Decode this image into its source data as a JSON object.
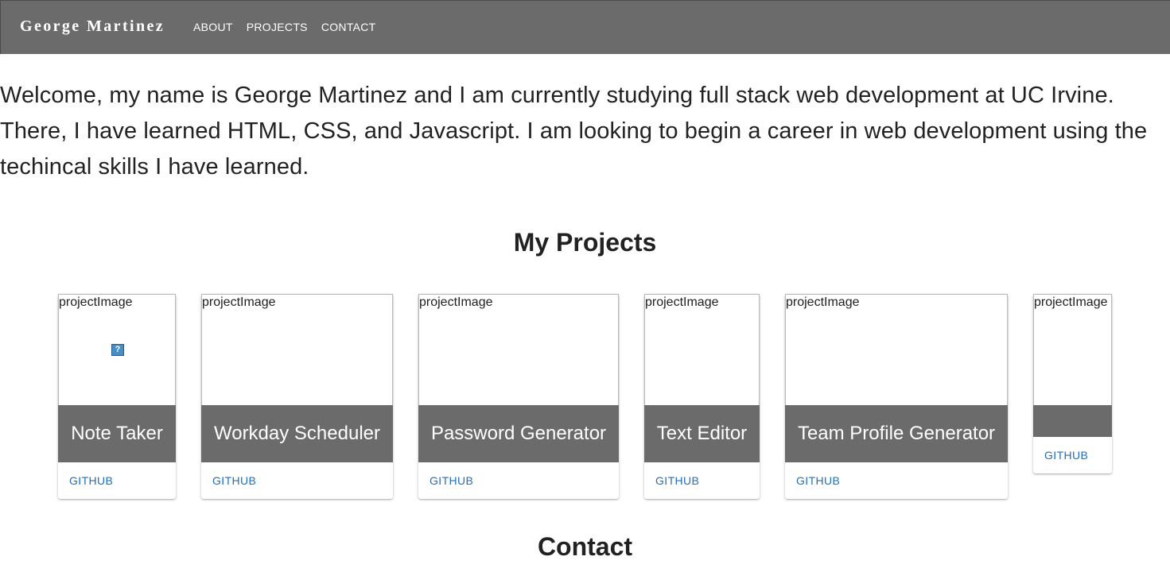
{
  "nav": {
    "brand": "George Martinez",
    "links": [
      "ABOUT",
      "PROJECTS",
      "CONTACT"
    ]
  },
  "about": {
    "text": "Welcome, my name is George Martinez and I am currently studying full stack web development at UC Irvine. There, I have learned HTML, CSS, and Javascript. I am looking to begin a career in web development using the techincal skills I have learned."
  },
  "projects": {
    "title": "My Projects",
    "image_alt": "projectImage",
    "action_label": "GITHUB",
    "broken_image_icon": "?",
    "cards": [
      {
        "title": "Note Taker"
      },
      {
        "title": "Workday Scheduler"
      },
      {
        "title": "Password Generator"
      },
      {
        "title": "Text Editor"
      },
      {
        "title": "Team Profile Generator"
      },
      {
        "title": ""
      }
    ]
  },
  "contact": {
    "title": "Contact"
  },
  "colors": {
    "navbar": "#6b6b6b",
    "link": "#1e6fc0",
    "text": "#212121"
  }
}
